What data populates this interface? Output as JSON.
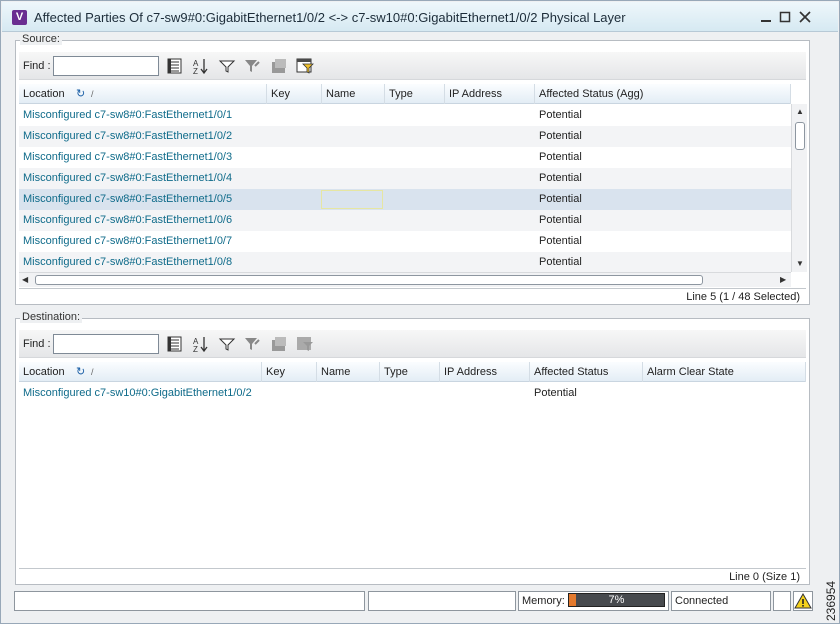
{
  "window": {
    "title": "Affected Parties Of c7-sw9#0:GigabitEthernet1/0/2 <-> c7-sw10#0:GigabitEthernet1/0/2 Physical Layer",
    "app_icon_letter": "V"
  },
  "source": {
    "label": "Source:",
    "find_label": "Find :",
    "find_value": "",
    "columns": [
      "Location",
      "Key",
      "Name",
      "Type",
      "IP Address",
      "Affected Status (Agg)"
    ],
    "rows": [
      {
        "location": "Misconfigured c7-sw8#0:FastEthernet1/0/1",
        "key": "",
        "name": "",
        "type": "",
        "ip": "",
        "status": "Potential"
      },
      {
        "location": "Misconfigured c7-sw8#0:FastEthernet1/0/2",
        "key": "",
        "name": "",
        "type": "",
        "ip": "",
        "status": "Potential"
      },
      {
        "location": "Misconfigured c7-sw8#0:FastEthernet1/0/3",
        "key": "",
        "name": "",
        "type": "",
        "ip": "",
        "status": "Potential"
      },
      {
        "location": "Misconfigured c7-sw8#0:FastEthernet1/0/4",
        "key": "",
        "name": "",
        "type": "",
        "ip": "",
        "status": "Potential"
      },
      {
        "location": "Misconfigured c7-sw8#0:FastEthernet1/0/5",
        "key": "",
        "name": "",
        "type": "",
        "ip": "",
        "status": "Potential"
      },
      {
        "location": "Misconfigured c7-sw8#0:FastEthernet1/0/6",
        "key": "",
        "name": "",
        "type": "",
        "ip": "",
        "status": "Potential"
      },
      {
        "location": "Misconfigured c7-sw8#0:FastEthernet1/0/7",
        "key": "",
        "name": "",
        "type": "",
        "ip": "",
        "status": "Potential"
      },
      {
        "location": "Misconfigured c7-sw8#0:FastEthernet1/0/8",
        "key": "",
        "name": "",
        "type": "",
        "ip": "",
        "status": "Potential"
      }
    ],
    "status_line": "Line 5 (1 / 48 Selected)"
  },
  "destination": {
    "label": "Destination:",
    "find_label": "Find :",
    "find_value": "",
    "columns": [
      "Location",
      "Key",
      "Name",
      "Type",
      "IP Address",
      "Affected Status",
      "Alarm Clear State"
    ],
    "rows": [
      {
        "location": "Misconfigured c7-sw10#0:GigabitEthernet1/0/2",
        "key": "",
        "name": "",
        "type": "",
        "ip": "",
        "status": "Potential",
        "alarm_clear": ""
      }
    ],
    "status_line": "Line 0 (Size 1)"
  },
  "statusbar": {
    "memory_label": "Memory:",
    "memory_percent": "7%",
    "memory_fraction": 0.07,
    "connection": "Connected"
  },
  "side_text": "236954",
  "colors": {
    "link": "#0f6b8a",
    "selected_row": "#d9e3ee",
    "memory_fill": "#e47a2e",
    "app_icon": "#6a2d91"
  }
}
